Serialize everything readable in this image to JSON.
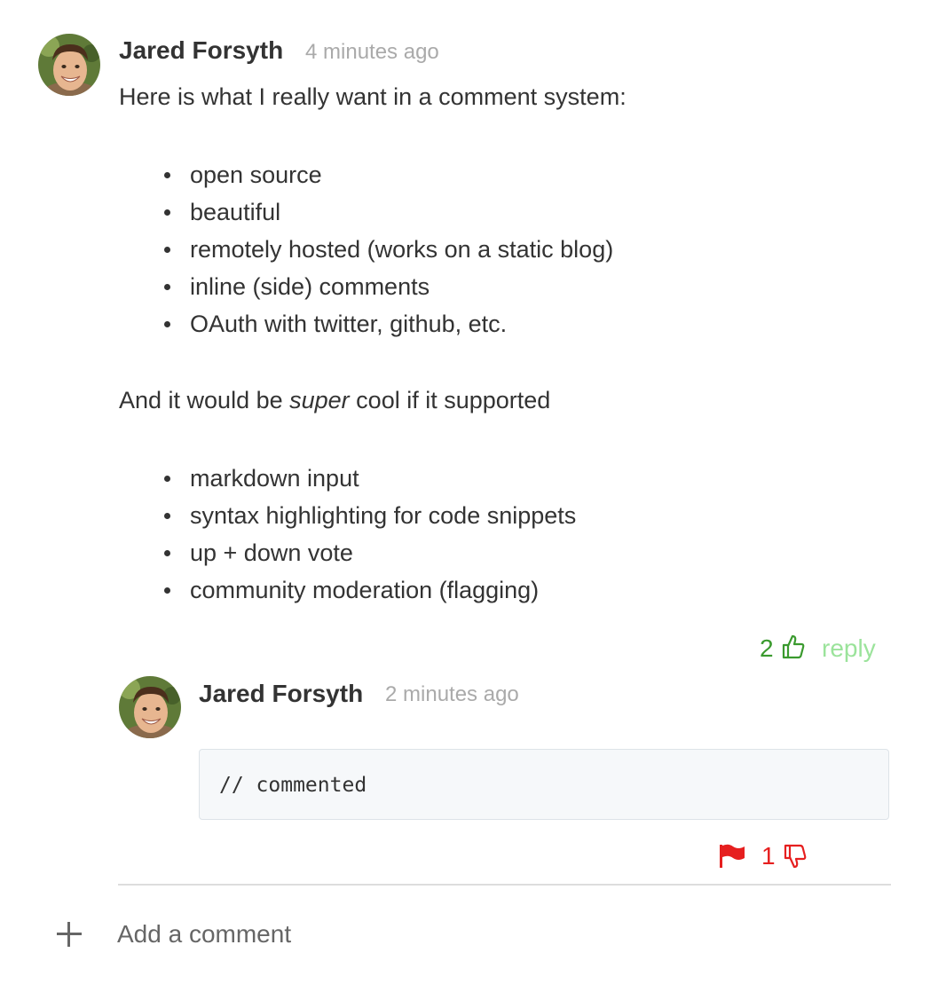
{
  "comment": {
    "author": "Jared Forsyth",
    "time": "4 minutes ago",
    "intro": "Here is what I really want in a comment system:",
    "wants": [
      "open source",
      "beautiful",
      "remotely hosted (works on a static blog)",
      "inline (side) comments",
      "OAuth with twitter, github, etc."
    ],
    "extra_before": "And it would be ",
    "extra_emphasis": "super",
    "extra_after": " cool if it supported",
    "nice_to_have": [
      "markdown input",
      "syntax highlighting for code snippets",
      "up + down vote",
      "community moderation (flagging)"
    ],
    "vote_count": "2",
    "vote_icon": "thumbs-up-icon",
    "reply_label": "reply"
  },
  "reply": {
    "author": "Jared Forsyth",
    "time": "2 minutes ago",
    "code": "// commented",
    "flag_icon": "flag-icon",
    "vote_count": "1",
    "vote_icon": "thumbs-down-icon"
  },
  "add_comment": {
    "icon": "plus-icon",
    "label": "Add a comment"
  },
  "colors": {
    "upvote": "#3a9a2e",
    "reply_link": "#9be39b",
    "downvote": "#e61f1f",
    "code_background": "#f6f8fa"
  }
}
